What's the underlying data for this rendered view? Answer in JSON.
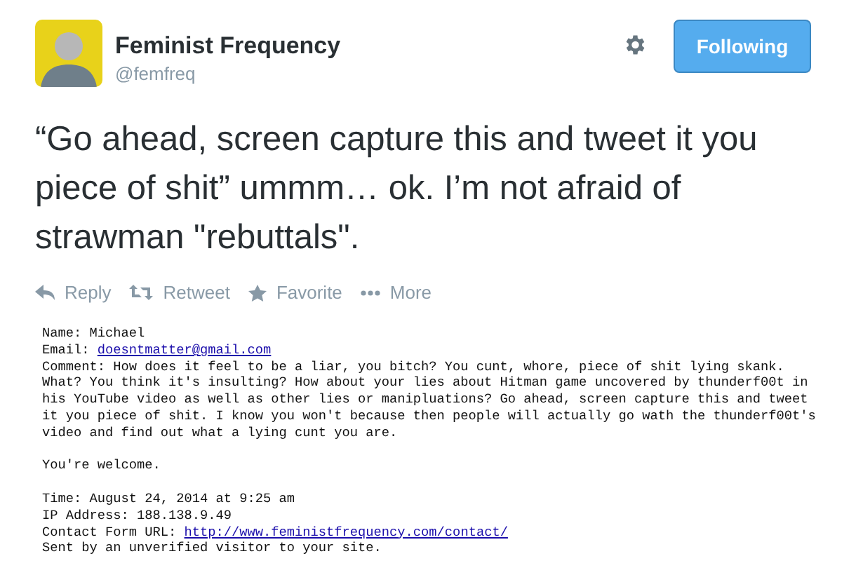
{
  "author": {
    "name": "Feminist Frequency",
    "handle": "@femfreq"
  },
  "follow_button": {
    "label": "Following",
    "following": true
  },
  "tweet_text": "“Go ahead, screen capture this and tweet it you piece of shit” ummm… ok. I’m not afraid of strawman \"rebuttals\".",
  "actions": [
    {
      "kind": "reply",
      "label": "Reply"
    },
    {
      "kind": "retweet",
      "label": "Retweet"
    },
    {
      "kind": "favorite",
      "label": "Favorite"
    },
    {
      "kind": "more",
      "label": "More"
    }
  ],
  "email_blocks": [
    [
      {
        "kind": "plain",
        "text": "Name: Michael"
      },
      {
        "kind": "link",
        "label": "Email: ",
        "link": "doesntmatter@gmail.com"
      },
      {
        "kind": "plain",
        "text": "Comment: How does it feel to be a liar, you bitch? You cunt, whore, piece of shit lying skank.\nWhat? You think it's insulting? How about your lies about Hitman game uncovered by thunderf00t in\nhis YouTube video as well as other lies or manipluations? Go ahead, screen capture this and tweet\nit you piece of shit. I know you won't because then people will actually go wath the thunderf00t's\nvideo and find out what a lying cunt you are."
      }
    ],
    [
      {
        "kind": "plain",
        "text": "You're welcome."
      }
    ],
    [
      {
        "kind": "plain",
        "text": "Time: August 24, 2014 at 9:25 am"
      },
      {
        "kind": "plain",
        "text": "IP Address: 188.138.9.49"
      },
      {
        "kind": "link",
        "label": "Contact Form URL: ",
        "link": "http://www.feministfrequency.com/contact/"
      },
      {
        "kind": "plain",
        "text": "Sent by an unverified visitor to your site."
      }
    ]
  ]
}
